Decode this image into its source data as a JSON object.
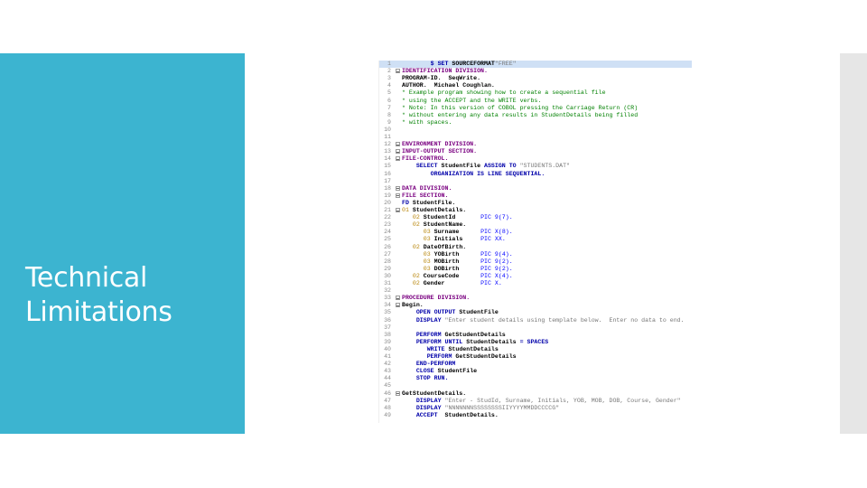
{
  "slide": {
    "title_lines": [
      "Technical",
      "Limitations"
    ],
    "accent_color": "#3cb4d0"
  },
  "editor": {
    "lines": [
      {
        "n": "1",
        "fold": false,
        "seg": [
          [
            "",
            "        "
          ],
          [
            "kw",
            "$ SET "
          ],
          [
            "dk",
            "SOURCEFORMAT"
          ],
          [
            "st",
            "\"FREE\""
          ]
        ]
      },
      {
        "n": "2",
        "fold": true,
        "seg": [
          [
            "div",
            "IDENTIFICATION DIVISION."
          ]
        ]
      },
      {
        "n": "3",
        "fold": false,
        "seg": [
          [
            "dk",
            "PROGRAM-ID.  SeqWrite."
          ]
        ]
      },
      {
        "n": "4",
        "fold": false,
        "seg": [
          [
            "dk",
            "AUTHOR.  Michael Coughlan."
          ]
        ]
      },
      {
        "n": "5",
        "fold": false,
        "seg": [
          [
            "cm",
            "* Example program showing how to create a sequential file"
          ]
        ]
      },
      {
        "n": "6",
        "fold": false,
        "seg": [
          [
            "cm",
            "* using the ACCEPT and the WRITE verbs."
          ]
        ]
      },
      {
        "n": "7",
        "fold": false,
        "seg": [
          [
            "cm",
            "* Note: In this version of COBOL pressing the Carriage Return (CR)"
          ]
        ]
      },
      {
        "n": "8",
        "fold": false,
        "seg": [
          [
            "cm",
            "* without entering any data results in StudentDetails being filled"
          ]
        ]
      },
      {
        "n": "9",
        "fold": false,
        "seg": [
          [
            "cm",
            "* with spaces."
          ]
        ]
      },
      {
        "n": "10",
        "fold": false,
        "seg": [
          [
            "",
            ""
          ]
        ]
      },
      {
        "n": "11",
        "fold": false,
        "seg": [
          [
            "",
            ""
          ]
        ]
      },
      {
        "n": "12",
        "fold": true,
        "seg": [
          [
            "div",
            "ENVIRONMENT DIVISION."
          ]
        ]
      },
      {
        "n": "13",
        "fold": true,
        "seg": [
          [
            "div",
            "INPUT-OUTPUT SECTION."
          ]
        ]
      },
      {
        "n": "14",
        "fold": true,
        "seg": [
          [
            "div",
            "FILE-CONTROL."
          ]
        ]
      },
      {
        "n": "15",
        "fold": false,
        "seg": [
          [
            "",
            "    "
          ],
          [
            "kw",
            "SELECT "
          ],
          [
            "dk",
            "StudentFile "
          ],
          [
            "kw",
            "ASSIGN TO "
          ],
          [
            "st",
            "\"STUDENTS.DAT\""
          ]
        ]
      },
      {
        "n": "16",
        "fold": false,
        "seg": [
          [
            "",
            "        "
          ],
          [
            "kw",
            "ORGANIZATION IS LINE SEQUENTIAL."
          ]
        ]
      },
      {
        "n": "17",
        "fold": false,
        "seg": [
          [
            "",
            ""
          ]
        ]
      },
      {
        "n": "18",
        "fold": true,
        "seg": [
          [
            "div",
            "DATA DIVISION."
          ]
        ]
      },
      {
        "n": "19",
        "fold": true,
        "seg": [
          [
            "div",
            "FILE SECTION."
          ]
        ]
      },
      {
        "n": "20",
        "fold": false,
        "seg": [
          [
            "kw",
            "FD "
          ],
          [
            "dk",
            "StudentFile."
          ]
        ]
      },
      {
        "n": "21",
        "fold": true,
        "seg": [
          [
            "lvl",
            "01 "
          ],
          [
            "dk",
            "StudentDetails."
          ]
        ]
      },
      {
        "n": "22",
        "fold": false,
        "seg": [
          [
            "",
            "   "
          ],
          [
            "lvl",
            "02 "
          ],
          [
            "dk",
            "StudentId       "
          ],
          [
            "pic",
            "PIC 9(7)."
          ]
        ]
      },
      {
        "n": "23",
        "fold": false,
        "seg": [
          [
            "",
            "   "
          ],
          [
            "lvl",
            "02 "
          ],
          [
            "dk",
            "StudentName."
          ]
        ]
      },
      {
        "n": "24",
        "fold": false,
        "seg": [
          [
            "",
            "      "
          ],
          [
            "lvl",
            "03 "
          ],
          [
            "dk",
            "Surname      "
          ],
          [
            "pic",
            "PIC X(8)."
          ]
        ]
      },
      {
        "n": "25",
        "fold": false,
        "seg": [
          [
            "",
            "      "
          ],
          [
            "lvl",
            "03 "
          ],
          [
            "dk",
            "Initials     "
          ],
          [
            "pic",
            "PIC XX."
          ]
        ]
      },
      {
        "n": "26",
        "fold": false,
        "seg": [
          [
            "",
            "   "
          ],
          [
            "lvl",
            "02 "
          ],
          [
            "dk",
            "DateOfBirth."
          ]
        ]
      },
      {
        "n": "27",
        "fold": false,
        "seg": [
          [
            "",
            "      "
          ],
          [
            "lvl",
            "03 "
          ],
          [
            "dk",
            "YOBirth      "
          ],
          [
            "pic",
            "PIC 9(4)."
          ]
        ]
      },
      {
        "n": "28",
        "fold": false,
        "seg": [
          [
            "",
            "      "
          ],
          [
            "lvl",
            "03 "
          ],
          [
            "dk",
            "MOBirth      "
          ],
          [
            "pic",
            "PIC 9(2)."
          ]
        ]
      },
      {
        "n": "29",
        "fold": false,
        "seg": [
          [
            "",
            "      "
          ],
          [
            "lvl",
            "03 "
          ],
          [
            "dk",
            "DOBirth      "
          ],
          [
            "pic",
            "PIC 9(2)."
          ]
        ]
      },
      {
        "n": "30",
        "fold": false,
        "seg": [
          [
            "",
            "   "
          ],
          [
            "lvl",
            "02 "
          ],
          [
            "dk",
            "CourseCode      "
          ],
          [
            "pic",
            "PIC X(4)."
          ]
        ]
      },
      {
        "n": "31",
        "fold": false,
        "seg": [
          [
            "",
            "   "
          ],
          [
            "lvl",
            "02 "
          ],
          [
            "dk",
            "Gender          "
          ],
          [
            "pic",
            "PIC X."
          ]
        ]
      },
      {
        "n": "32",
        "fold": false,
        "seg": [
          [
            "",
            ""
          ]
        ]
      },
      {
        "n": "33",
        "fold": true,
        "seg": [
          [
            "div",
            "PROCEDURE DIVISION."
          ]
        ]
      },
      {
        "n": "34",
        "fold": true,
        "seg": [
          [
            "dk",
            "Begin."
          ]
        ]
      },
      {
        "n": "35",
        "fold": false,
        "seg": [
          [
            "",
            "    "
          ],
          [
            "kw",
            "OPEN OUTPUT "
          ],
          [
            "dk",
            "StudentFile"
          ]
        ]
      },
      {
        "n": "36",
        "fold": false,
        "seg": [
          [
            "",
            "    "
          ],
          [
            "kw",
            "DISPLAY "
          ],
          [
            "st",
            "\"Enter student details using template below.  Enter no data to end."
          ]
        ]
      },
      {
        "n": "37",
        "fold": false,
        "seg": [
          [
            "",
            ""
          ]
        ]
      },
      {
        "n": "38",
        "fold": false,
        "seg": [
          [
            "",
            "    "
          ],
          [
            "kw",
            "PERFORM "
          ],
          [
            "dk",
            "GetStudentDetails"
          ]
        ]
      },
      {
        "n": "39",
        "fold": false,
        "seg": [
          [
            "",
            "    "
          ],
          [
            "kw",
            "PERFORM UNTIL "
          ],
          [
            "dk",
            "StudentDetails "
          ],
          [
            "kw",
            "= SPACES"
          ]
        ]
      },
      {
        "n": "40",
        "fold": false,
        "seg": [
          [
            "",
            "       "
          ],
          [
            "kw",
            "WRITE "
          ],
          [
            "dk",
            "StudentDetails"
          ]
        ]
      },
      {
        "n": "41",
        "fold": false,
        "seg": [
          [
            "",
            "       "
          ],
          [
            "kw",
            "PERFORM "
          ],
          [
            "dk",
            "GetStudentDetails"
          ]
        ]
      },
      {
        "n": "42",
        "fold": false,
        "seg": [
          [
            "",
            "    "
          ],
          [
            "kw",
            "END-PERFORM"
          ]
        ]
      },
      {
        "n": "43",
        "fold": false,
        "seg": [
          [
            "",
            "    "
          ],
          [
            "kw",
            "CLOSE "
          ],
          [
            "dk",
            "StudentFile"
          ]
        ]
      },
      {
        "n": "44",
        "fold": false,
        "seg": [
          [
            "",
            "    "
          ],
          [
            "kw",
            "STOP RUN."
          ]
        ]
      },
      {
        "n": "45",
        "fold": false,
        "seg": [
          [
            "",
            ""
          ]
        ]
      },
      {
        "n": "46",
        "fold": true,
        "seg": [
          [
            "dk",
            "GetStudentDetails."
          ]
        ]
      },
      {
        "n": "47",
        "fold": false,
        "seg": [
          [
            "",
            "    "
          ],
          [
            "kw",
            "DISPLAY "
          ],
          [
            "st",
            "\"Enter - StudId, Surname, Initials, YOB, MOB, DOB, Course, Gender\""
          ]
        ]
      },
      {
        "n": "48",
        "fold": false,
        "seg": [
          [
            "",
            "    "
          ],
          [
            "kw",
            "DISPLAY "
          ],
          [
            "st",
            "\"NNNNNNNSSSSSSSSIIYYYYMMDDCCCCG\""
          ]
        ]
      },
      {
        "n": "49",
        "fold": false,
        "seg": [
          [
            "",
            "    "
          ],
          [
            "kw",
            "ACCEPT  "
          ],
          [
            "dk",
            "StudentDetails."
          ]
        ]
      }
    ]
  }
}
